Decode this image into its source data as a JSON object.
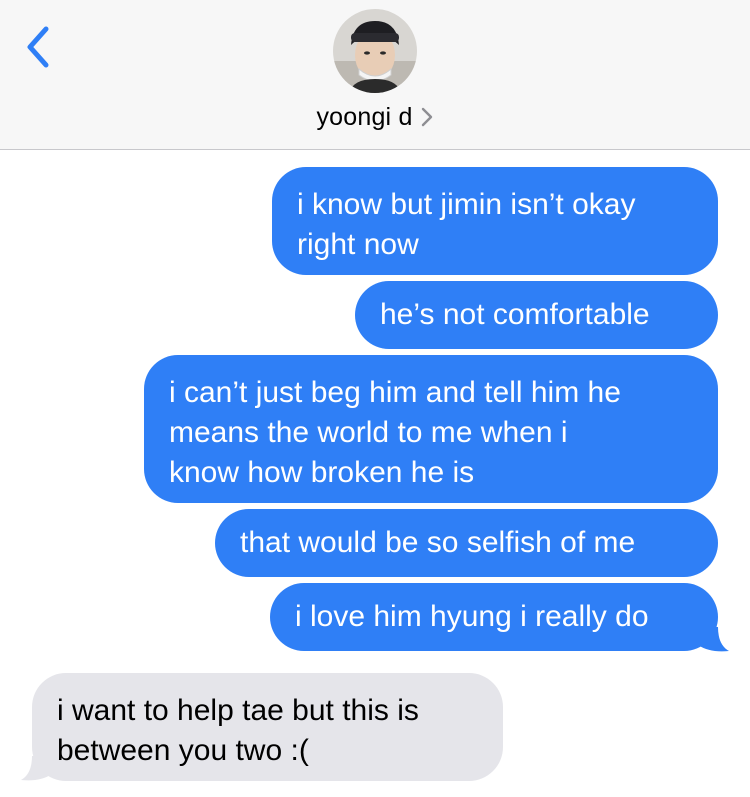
{
  "header": {
    "back_icon": "chevron-left-icon",
    "contact_name": "yoongi d",
    "contact_chevron_icon": "chevron-right-icon",
    "avatar_icon": "contact-avatar-photo"
  },
  "colors": {
    "sent_bubble": "#2f7ff6",
    "received_bubble": "#e5e5ea",
    "accent": "#2f7ff6",
    "header_bg": "#f7f7f7"
  },
  "messages": [
    {
      "direction": "sent",
      "lines": [
        "i know but jimin isn’t okay",
        "right now"
      ]
    },
    {
      "direction": "sent",
      "lines": [
        "he’s not comfortable"
      ]
    },
    {
      "direction": "sent",
      "lines": [
        "i can’t just beg him and tell him he",
        "means the world to me when i",
        "know how broken he is"
      ]
    },
    {
      "direction": "sent",
      "lines": [
        "that would be so selfish of me"
      ]
    },
    {
      "direction": "sent",
      "lines": [
        "i love him hyung i really do"
      ]
    },
    {
      "direction": "received",
      "lines": [
        "i want to help tae but this is",
        "between you two :("
      ]
    }
  ]
}
